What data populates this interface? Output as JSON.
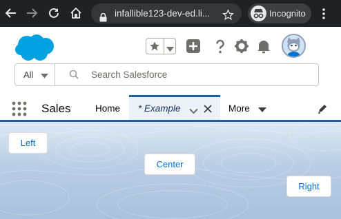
{
  "browser": {
    "url": "infallible123-dev-ed.li...",
    "incognito_label": "Incognito",
    "icons": [
      "back-arrow-icon",
      "forward-arrow-icon",
      "reload-icon",
      "home-icon",
      "lock-icon",
      "star-icon",
      "incognito-icon",
      "kebab-menu-icon"
    ]
  },
  "header": {
    "search_scope": "All",
    "search_placeholder": "Search Salesforce",
    "icons": [
      "favorites-star-icon",
      "global-add-icon",
      "help-icon",
      "setup-gear-icon",
      "notifications-bell-icon",
      "user-avatar"
    ]
  },
  "nav": {
    "app_name": "Sales",
    "home": "Home",
    "active_tab": "* Example",
    "more": "More"
  },
  "content": {
    "buttons": {
      "left": "Left",
      "center": "Center",
      "right": "Right"
    }
  },
  "colors": {
    "chrome_bg": "#202124",
    "brand_blue": "#1b5fa5",
    "link_blue": "#0070d2",
    "cloud_blue": "#00a1e0",
    "active_tab_bg": "#ecf1f8"
  }
}
